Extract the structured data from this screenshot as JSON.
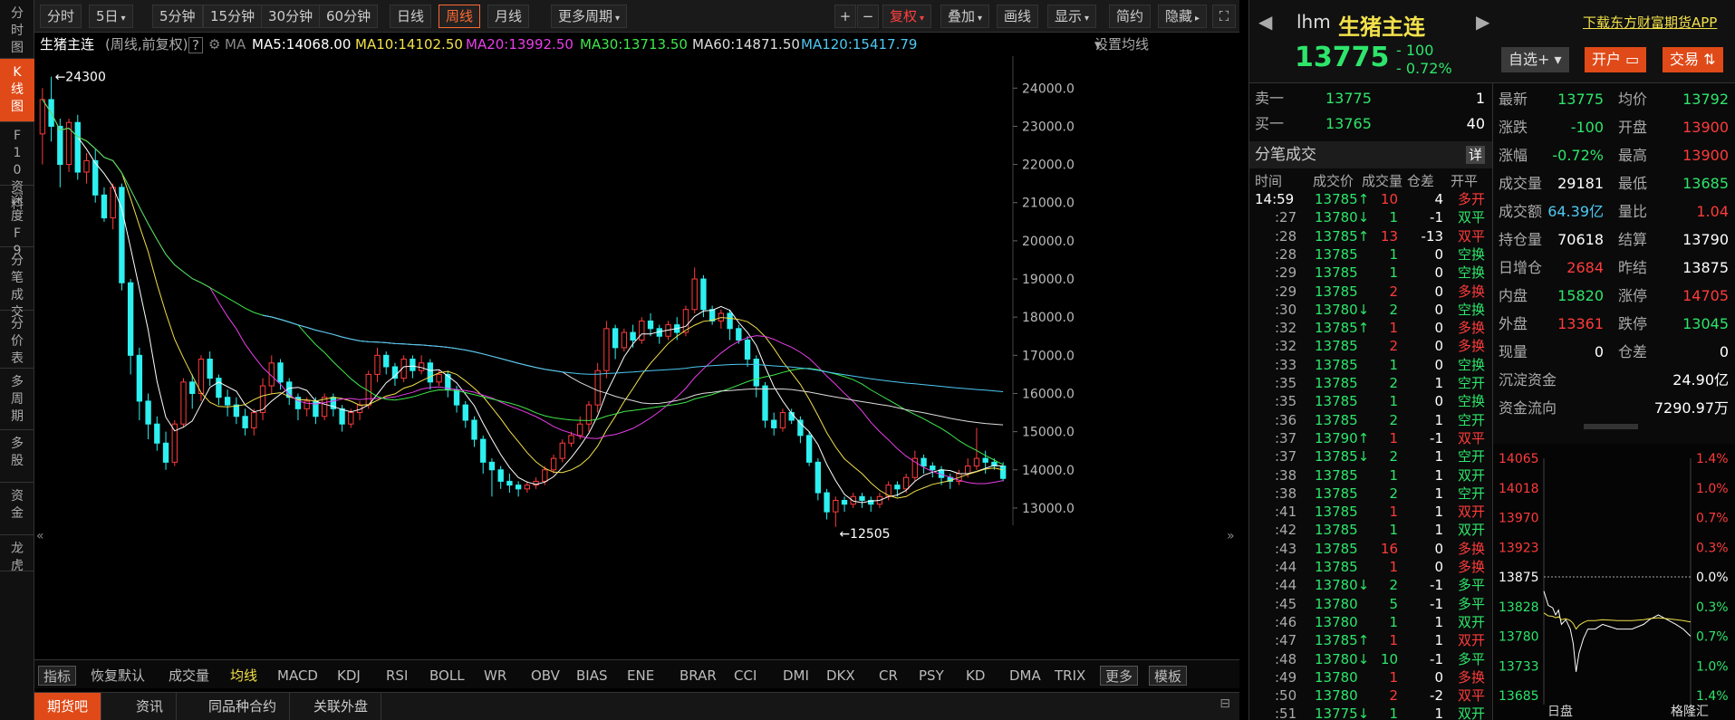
{
  "left_nav": [
    {
      "label": "分时图"
    },
    {
      "label": "K线图",
      "active": true
    },
    {
      "label": "F10资料"
    },
    {
      "label": "深度F9"
    },
    {
      "label": "分笔成交"
    },
    {
      "label": "分价表"
    },
    {
      "label": "多周期"
    },
    {
      "label": "多股"
    },
    {
      "label": "资金"
    },
    {
      "label": "龙虎"
    }
  ],
  "toolbar": {
    "periods": [
      "分时",
      "5日",
      "5分钟",
      "15分钟",
      "30分钟",
      "60分钟",
      "日线",
      "周线",
      "月线",
      "更多周期"
    ],
    "active_period": "周线",
    "right_buttons": [
      "+",
      "−",
      "复权",
      "叠加",
      "画线",
      "显示",
      "简约",
      "隐藏"
    ]
  },
  "ma_legend": {
    "name": "生猪主连",
    "mode": "(周线,前复权)",
    "help": "?",
    "ma_label": "MA",
    "ma5": "MA5:14068.00",
    "ma10": "MA10:14102.50",
    "ma20": "MA20:13992.50",
    "ma30": "MA30:13713.50",
    "ma60": "MA60:14871.50",
    "ma120": "MA120:15417.79",
    "settings": "设置均线"
  },
  "chart_data": {
    "type": "candlestick",
    "title": "生猪主连",
    "y_ticks": [
      "24000.0",
      "23000.0",
      "22000.0",
      "21000.0",
      "20000.0",
      "19000.0",
      "18000.0",
      "17000.0",
      "16000.0",
      "15000.0",
      "14000.0",
      "13000.0"
    ],
    "ylim": [
      12500,
      24600
    ],
    "high_marker": "24300",
    "low_marker": "12505",
    "candles_approx": [
      [
        22800,
        23700,
        22000,
        24000
      ],
      [
        23700,
        23000,
        22600,
        24300
      ],
      [
        23000,
        22000,
        21400,
        23200
      ],
      [
        22000,
        23100,
        21800,
        23200
      ],
      [
        23100,
        21800,
        21600,
        23300
      ],
      [
        21800,
        22100,
        21500,
        22300
      ],
      [
        22100,
        21200,
        21000,
        22400
      ],
      [
        21200,
        20600,
        20500,
        21400
      ],
      [
        20600,
        21400,
        20300,
        21500
      ],
      [
        21400,
        18900,
        18700,
        21500
      ],
      [
        18900,
        17000,
        16500,
        19000
      ],
      [
        17000,
        15800,
        15300,
        17200
      ],
      [
        15800,
        15200,
        14800,
        16000
      ],
      [
        15200,
        14700,
        14500,
        15400
      ],
      [
        14700,
        14200,
        14000,
        15000
      ],
      [
        14200,
        15200,
        14100,
        15300
      ],
      [
        15200,
        16300,
        15100,
        16400
      ],
      [
        16300,
        16000,
        15600,
        16500
      ],
      [
        16000,
        16900,
        15800,
        17000
      ],
      [
        16900,
        16400,
        16200,
        17100
      ],
      [
        16400,
        15900,
        15700,
        16500
      ],
      [
        15900,
        15700,
        15400,
        16100
      ],
      [
        15700,
        15400,
        15200,
        15900
      ],
      [
        15400,
        15100,
        14900,
        15600
      ],
      [
        15100,
        15500,
        14900,
        15600
      ],
      [
        15500,
        16200,
        15300,
        16400
      ],
      [
        16200,
        16800,
        16000,
        17000
      ],
      [
        16800,
        16300,
        16100,
        16900
      ],
      [
        16300,
        15900,
        15700,
        16400
      ],
      [
        15900,
        15600,
        15300,
        16000
      ],
      [
        15600,
        15800,
        15400,
        15900
      ],
      [
        15800,
        15400,
        15200,
        15900
      ],
      [
        15400,
        15900,
        15300,
        16000
      ],
      [
        15900,
        15600,
        15400,
        16000
      ],
      [
        15600,
        15200,
        15000,
        15700
      ],
      [
        15200,
        15500,
        15100,
        15600
      ],
      [
        15500,
        15700,
        15300,
        15800
      ],
      [
        15700,
        16500,
        15600,
        16600
      ],
      [
        16500,
        17000,
        16300,
        17200
      ],
      [
        17000,
        16700,
        16500,
        17100
      ],
      [
        16700,
        16400,
        16200,
        16800
      ],
      [
        16400,
        16900,
        16300,
        17000
      ],
      [
        16900,
        16600,
        16400,
        17000
      ],
      [
        16600,
        16800,
        16500,
        17000
      ],
      [
        16800,
        16300,
        16100,
        16900
      ],
      [
        16300,
        16500,
        16200,
        16600
      ],
      [
        16500,
        16100,
        15900,
        16600
      ],
      [
        16100,
        15700,
        15500,
        16200
      ],
      [
        15700,
        15300,
        15100,
        15800
      ],
      [
        15300,
        14800,
        14600,
        15400
      ],
      [
        14800,
        14200,
        13900,
        14900
      ],
      [
        14200,
        14000,
        13300,
        14300
      ],
      [
        14000,
        13700,
        13500,
        14100
      ],
      [
        13700,
        13600,
        13400,
        13900
      ],
      [
        13600,
        13500,
        13300,
        13700
      ],
      [
        13500,
        13600,
        13400,
        13700
      ],
      [
        13600,
        13700,
        13500,
        13800
      ],
      [
        13700,
        14000,
        13600,
        14100
      ],
      [
        14000,
        14300,
        13900,
        14400
      ],
      [
        14300,
        14700,
        14200,
        14800
      ],
      [
        14700,
        14900,
        14600,
        15000
      ],
      [
        14900,
        15200,
        14800,
        15400
      ],
      [
        15200,
        15700,
        15000,
        15800
      ],
      [
        15700,
        16600,
        15500,
        16800
      ],
      [
        16600,
        17700,
        16400,
        17900
      ],
      [
        17700,
        17200,
        16900,
        17800
      ],
      [
        17200,
        17600,
        17100,
        17700
      ],
      [
        17600,
        17400,
        17200,
        17800
      ],
      [
        17400,
        17900,
        17300,
        18000
      ],
      [
        17900,
        17700,
        17500,
        18100
      ],
      [
        17700,
        17500,
        17300,
        17800
      ],
      [
        17500,
        17800,
        17400,
        17900
      ],
      [
        17800,
        17600,
        17400,
        18000
      ],
      [
        17600,
        18200,
        17500,
        18300
      ],
      [
        18200,
        19000,
        18100,
        19300
      ],
      [
        19000,
        18200,
        18000,
        19100
      ],
      [
        18200,
        17900,
        17800,
        18300
      ],
      [
        17900,
        18100,
        17700,
        18200
      ],
      [
        18100,
        17700,
        17400,
        18200
      ],
      [
        17700,
        17400,
        17300,
        17800
      ],
      [
        17400,
        16900,
        16700,
        17500
      ],
      [
        16900,
        16200,
        15900,
        17000
      ],
      [
        16200,
        15300,
        15100,
        16300
      ],
      [
        15300,
        15100,
        14900,
        15500
      ],
      [
        15100,
        15500,
        15000,
        15600
      ],
      [
        15500,
        15300,
        15200,
        15600
      ],
      [
        15300,
        14900,
        14700,
        15400
      ],
      [
        14900,
        14200,
        14100,
        15000
      ],
      [
        14200,
        13400,
        13200,
        14300
      ],
      [
        13400,
        12900,
        12700,
        13500
      ],
      [
        12900,
        13200,
        12505,
        13300
      ],
      [
        13200,
        13100,
        12900,
        13300
      ],
      [
        13100,
        13300,
        13000,
        13400
      ],
      [
        13300,
        13200,
        13000,
        13400
      ],
      [
        13200,
        13100,
        12900,
        13300
      ],
      [
        13100,
        13300,
        13000,
        13400
      ],
      [
        13300,
        13600,
        13200,
        13700
      ],
      [
        13600,
        13500,
        13300,
        13700
      ],
      [
        13500,
        13800,
        13400,
        13900
      ],
      [
        13800,
        14300,
        13700,
        14500
      ],
      [
        14300,
        14100,
        13900,
        14400
      ],
      [
        14100,
        14000,
        13800,
        14200
      ],
      [
        14000,
        13800,
        13600,
        14100
      ],
      [
        13800,
        13700,
        13500,
        13900
      ],
      [
        13700,
        13900,
        13600,
        14000
      ],
      [
        13900,
        14100,
        13800,
        14300
      ],
      [
        14100,
        14300,
        14000,
        15100
      ],
      [
        14300,
        14200,
        13900,
        14500
      ],
      [
        14200,
        14100,
        14000,
        14300
      ],
      [
        14100,
        13775,
        13700,
        14200
      ]
    ]
  },
  "indicators": {
    "left_box": "指标",
    "items": [
      "恢复默认",
      "成交量",
      "均线",
      "MACD",
      "KDJ",
      "RSI",
      "BOLL",
      "WR",
      "OBV",
      "BIAS",
      "ENE",
      "BRAR",
      "CCI",
      "DMI",
      "DKX",
      "CR",
      "PSY",
      "KD",
      "DMA",
      "TRIX"
    ],
    "more": "更多",
    "template": "模板"
  },
  "bottom_tabs": [
    "期货吧",
    "资讯",
    "同品种合约",
    "关联外盘"
  ],
  "quote": {
    "code": "lhm",
    "name": "生猪主连",
    "price": "13775",
    "change": "- 100",
    "change_pct": "- 0.72%",
    "watchlist_btn": "自选+",
    "open_btn": "开户",
    "trade_btn": "交易",
    "download_link": "下载东方财富期货APP"
  },
  "orderbook": {
    "ask_label": "卖一",
    "ask_price": "13775",
    "ask_vol": "1",
    "bid_label": "买一",
    "bid_price": "13765",
    "bid_vol": "40"
  },
  "ticks": {
    "title": "分笔成交",
    "detail_btn": "详",
    "headers": [
      "时间",
      "成交价",
      "成交量",
      "仓差",
      "开平"
    ],
    "rows": [
      {
        "t": "14:59",
        "p": "13785↑",
        "v": "10",
        "d": "4",
        "k": "多开",
        "pc": "green",
        "vc": "red",
        "kc": "red"
      },
      {
        "t": ":27",
        "p": "13780↓",
        "v": "1",
        "d": "-1",
        "k": "双平",
        "pc": "green",
        "vc": "green",
        "kc": "green"
      },
      {
        "t": ":28",
        "p": "13785↑",
        "v": "13",
        "d": "-13",
        "k": "双平",
        "pc": "green",
        "vc": "red",
        "kc": "red"
      },
      {
        "t": ":28",
        "p": "13785",
        "v": "1",
        "d": "0",
        "k": "空换",
        "pc": "green",
        "vc": "green",
        "kc": "green"
      },
      {
        "t": ":29",
        "p": "13785",
        "v": "1",
        "d": "0",
        "k": "空换",
        "pc": "green",
        "vc": "green",
        "kc": "green"
      },
      {
        "t": ":29",
        "p": "13785",
        "v": "2",
        "d": "0",
        "k": "多换",
        "pc": "green",
        "vc": "red",
        "kc": "red"
      },
      {
        "t": ":30",
        "p": "13780↓",
        "v": "2",
        "d": "0",
        "k": "空换",
        "pc": "green",
        "vc": "green",
        "kc": "green"
      },
      {
        "t": ":32",
        "p": "13785↑",
        "v": "1",
        "d": "0",
        "k": "多换",
        "pc": "green",
        "vc": "red",
        "kc": "red"
      },
      {
        "t": ":32",
        "p": "13785",
        "v": "2",
        "d": "0",
        "k": "多换",
        "pc": "green",
        "vc": "red",
        "kc": "red"
      },
      {
        "t": ":33",
        "p": "13785",
        "v": "1",
        "d": "0",
        "k": "空换",
        "pc": "green",
        "vc": "green",
        "kc": "green"
      },
      {
        "t": ":35",
        "p": "13785",
        "v": "2",
        "d": "1",
        "k": "空开",
        "pc": "green",
        "vc": "green",
        "kc": "green"
      },
      {
        "t": ":35",
        "p": "13785",
        "v": "1",
        "d": "0",
        "k": "空换",
        "pc": "green",
        "vc": "green",
        "kc": "green"
      },
      {
        "t": ":36",
        "p": "13785",
        "v": "2",
        "d": "1",
        "k": "空开",
        "pc": "green",
        "vc": "green",
        "kc": "green"
      },
      {
        "t": ":37",
        "p": "13790↑",
        "v": "1",
        "d": "-1",
        "k": "双平",
        "pc": "green",
        "vc": "red",
        "kc": "red"
      },
      {
        "t": ":37",
        "p": "13785↓",
        "v": "2",
        "d": "1",
        "k": "空开",
        "pc": "green",
        "vc": "green",
        "kc": "green"
      },
      {
        "t": ":38",
        "p": "13785",
        "v": "1",
        "d": "1",
        "k": "双开",
        "pc": "green",
        "vc": "green",
        "kc": "green"
      },
      {
        "t": ":38",
        "p": "13785",
        "v": "2",
        "d": "1",
        "k": "空开",
        "pc": "green",
        "vc": "green",
        "kc": "green"
      },
      {
        "t": ":41",
        "p": "13785",
        "v": "1",
        "d": "1",
        "k": "双开",
        "pc": "green",
        "vc": "red",
        "kc": "red"
      },
      {
        "t": ":42",
        "p": "13785",
        "v": "1",
        "d": "1",
        "k": "双开",
        "pc": "green",
        "vc": "green",
        "kc": "green"
      },
      {
        "t": ":43",
        "p": "13785",
        "v": "16",
        "d": "0",
        "k": "多换",
        "pc": "green",
        "vc": "red",
        "kc": "red"
      },
      {
        "t": ":44",
        "p": "13785",
        "v": "1",
        "d": "0",
        "k": "多换",
        "pc": "green",
        "vc": "red",
        "kc": "red"
      },
      {
        "t": ":44",
        "p": "13780↓",
        "v": "2",
        "d": "-1",
        "k": "多平",
        "pc": "green",
        "vc": "green",
        "kc": "green"
      },
      {
        "t": ":45",
        "p": "13780",
        "v": "5",
        "d": "-1",
        "k": "多平",
        "pc": "green",
        "vc": "green",
        "kc": "green"
      },
      {
        "t": ":46",
        "p": "13780",
        "v": "1",
        "d": "1",
        "k": "双开",
        "pc": "green",
        "vc": "green",
        "kc": "green"
      },
      {
        "t": ":47",
        "p": "13785↑",
        "v": "1",
        "d": "1",
        "k": "双开",
        "pc": "green",
        "vc": "red",
        "kc": "red"
      },
      {
        "t": ":48",
        "p": "13780↓",
        "v": "10",
        "d": "-1",
        "k": "多平",
        "pc": "green",
        "vc": "green",
        "kc": "green"
      },
      {
        "t": ":49",
        "p": "13780",
        "v": "1",
        "d": "0",
        "k": "多换",
        "pc": "green",
        "vc": "red",
        "kc": "red"
      },
      {
        "t": ":50",
        "p": "13780",
        "v": "2",
        "d": "-2",
        "k": "双平",
        "pc": "green",
        "vc": "red",
        "kc": "red"
      },
      {
        "t": ":51",
        "p": "13775↓",
        "v": "1",
        "d": "1",
        "k": "双开",
        "pc": "green",
        "vc": "green",
        "kc": "green"
      }
    ]
  },
  "stats": [
    {
      "l1": "最新",
      "v1": "13775",
      "c1": "green",
      "l2": "均价",
      "v2": "13792",
      "c2": "green"
    },
    {
      "l1": "涨跌",
      "v1": "-100",
      "c1": "green",
      "l2": "开盘",
      "v2": "13900",
      "c2": "red"
    },
    {
      "l1": "涨幅",
      "v1": "-0.72%",
      "c1": "green",
      "l2": "最高",
      "v2": "13900",
      "c2": "red"
    },
    {
      "l1": "成交量",
      "v1": "29181",
      "c1": "white",
      "l2": "最低",
      "v2": "13685",
      "c2": "green"
    },
    {
      "l1": "成交额",
      "v1": "64.39亿",
      "c1": "blue",
      "l2": "量比",
      "v2": "1.04",
      "c2": "red"
    },
    {
      "l1": "持仓量",
      "v1": "70618",
      "c1": "white",
      "l2": "结算",
      "v2": "13790",
      "c2": "white"
    },
    {
      "l1": "日增仓",
      "v1": "2684",
      "c1": "red",
      "l2": "昨结",
      "v2": "13875",
      "c2": "white"
    },
    {
      "l1": "内盘",
      "v1": "15820",
      "c1": "green",
      "l2": "涨停",
      "v2": "14705",
      "c2": "red"
    },
    {
      "l1": "外盘",
      "v1": "13361",
      "c1": "red",
      "l2": "跌停",
      "v2": "13045",
      "c2": "green"
    },
    {
      "l1": "现量",
      "v1": "0",
      "c1": "white",
      "l2": "仓差",
      "v2": "0",
      "c2": "white"
    }
  ],
  "fund": {
    "sediment_label": "沉淀资金",
    "sediment_value": "24.90亿",
    "flow_label": "资金流向",
    "flow_value": "7290.97万"
  },
  "mini_chart": {
    "left_ticks": [
      "14065",
      "14018",
      "13970",
      "13923",
      "13875",
      "13828",
      "13780",
      "13733",
      "13685"
    ],
    "right_ticks": [
      "1.4%",
      "1.0%",
      "0.7%",
      "0.3%",
      "0.0%",
      "0.3%",
      "0.7%",
      "1.0%",
      "1.4%"
    ],
    "tab": "日盘",
    "watermark": "格隆汇"
  },
  "colors": {
    "up": "#ff3b3b",
    "down": "#2ee56b",
    "accent": "#e04a18"
  }
}
